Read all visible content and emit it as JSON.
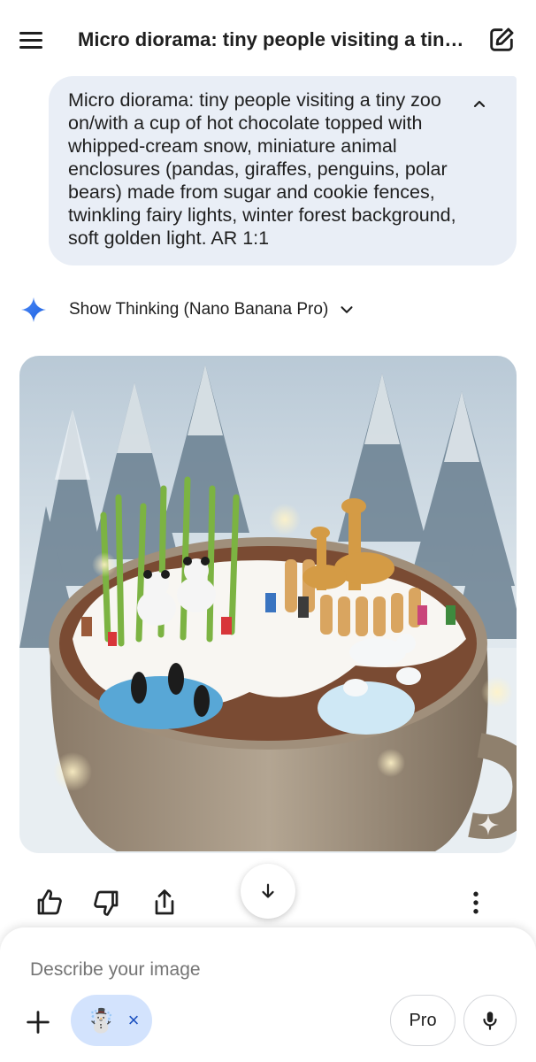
{
  "header": {
    "title": "Micro diorama: tiny people visiting a tiny..."
  },
  "prompt": {
    "text": "Micro diorama: tiny people visiting a tiny zoo on/with a cup of hot chocolate topped with whipped-cream snow, miniature animal enclosures (pandas, giraffes, penguins, polar bears) made from sugar and cookie fences, twinkling fairy lights, winter forest background, soft golden light. AR 1:1"
  },
  "thinking": {
    "label": "Show Thinking (Nano Banana Pro)"
  },
  "composer": {
    "placeholder": "Describe your image",
    "attachment_emoji": "☃️",
    "attachment_remove": "×",
    "pro_label": "Pro"
  },
  "colors": {
    "accent": "#1a73e8",
    "bubble": "#e9eef6",
    "chip": "#d3e3fd"
  }
}
